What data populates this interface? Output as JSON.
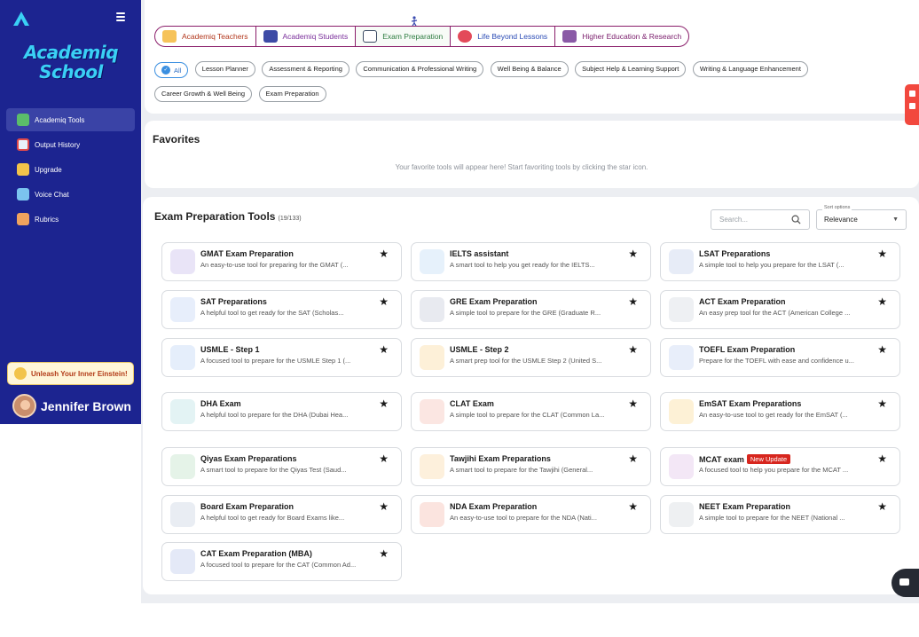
{
  "sidebar": {
    "logo_line1": "Academiq",
    "logo_line2": "School",
    "nav": [
      {
        "label": "Academiq Tools",
        "icon": "tools-icon",
        "active": true
      },
      {
        "label": "Output History",
        "icon": "history-icon",
        "active": false
      },
      {
        "label": "Upgrade",
        "icon": "upgrade-icon",
        "active": false
      },
      {
        "label": "Voice Chat",
        "icon": "voice-chat-icon",
        "active": false
      },
      {
        "label": "Rubrics",
        "icon": "rubrics-icon",
        "active": false
      }
    ],
    "promo": "Unleash Your Inner Einstein!",
    "user_name": "Jennifer Brown"
  },
  "categories": [
    {
      "label": "Academiq Teachers",
      "icon": "teacher-icon"
    },
    {
      "label": "Academiq Students",
      "icon": "students-icon"
    },
    {
      "label": "Exam Preparation",
      "icon": "book-icon"
    },
    {
      "label": "Life Beyond Lessons",
      "icon": "person-icon"
    },
    {
      "label": "Higher Education & Research",
      "icon": "university-icon"
    }
  ],
  "filters": [
    "All",
    "Lesson Planner",
    "Assessment & Reporting",
    "Communication & Professional Writing",
    "Well Being & Balance",
    "Subject Help & Learning Support",
    "Writing & Language Enhancement",
    "Career Growth & Well Being",
    "Exam Preparation"
  ],
  "favorites": {
    "title": "Favorites",
    "empty": "Your favorite tools will appear here! Start favoriting tools by clicking the star icon."
  },
  "tools": {
    "title": "Exam Preparation Tools",
    "count": "(19/133)",
    "search_placeholder": "Search...",
    "sort_label": "Sort options",
    "sort_value": "Relevance",
    "star": "★",
    "badge": "New Update",
    "items": [
      {
        "title": "GMAT Exam Preparation",
        "desc": "An easy-to-use tool for preparing for the GMAT (...",
        "icon": "gmat-icon",
        "color": "#e9e4f7"
      },
      {
        "title": "IELTS assistant",
        "desc": "A smart tool to help you get ready for the IELTS...",
        "icon": "ielts-icon",
        "color": "#e6f1fb"
      },
      {
        "title": "LSAT Preparations",
        "desc": "A simple tool to help you prepare for the LSAT (...",
        "icon": "lsat-icon",
        "color": "#e7ecf7"
      },
      {
        "title": "SAT Preparations",
        "desc": "A helpful tool to get ready for the SAT (Scholas...",
        "icon": "sat-icon",
        "color": "#e7eefb"
      },
      {
        "title": "GRE Exam Preparation",
        "desc": "A simple tool to prepare for the GRE (Graduate R...",
        "icon": "gre-icon",
        "color": "#e8eaf0"
      },
      {
        "title": "ACT Exam Preparation",
        "desc": "An easy prep tool for the ACT (American College ...",
        "icon": "act-icon",
        "color": "#eef0f3"
      },
      {
        "title": "USMLE - Step 1",
        "desc": "A focused tool to prepare for the USMLE Step 1 (...",
        "icon": "usmle1-icon",
        "color": "#e5eefb"
      },
      {
        "title": "USMLE - Step 2",
        "desc": "A smart prep tool for the USMLE Step 2 (United S...",
        "icon": "usmle2-icon",
        "color": "#fdf0d8"
      },
      {
        "title": "TOEFL Exam Preparation",
        "desc": "Prepare for the TOEFL with ease and confidence u...",
        "icon": "toefl-icon",
        "color": "#e8eefa"
      },
      {
        "title": "DHA Exam",
        "desc": "A helpful tool to prepare for the DHA (Dubai Hea...",
        "icon": "dha-icon",
        "color": "#e3f3f4"
      },
      {
        "title": "CLAT Exam",
        "desc": "A simple tool to prepare for the CLAT (Common La...",
        "icon": "clat-icon",
        "color": "#fbe6e2"
      },
      {
        "title": "EmSAT Exam Preparations",
        "desc": "An easy-to-use tool to get ready for the EmSAT (...",
        "icon": "emsat-icon",
        "color": "#fdf1d6"
      },
      {
        "title": "Qiyas Exam Preparations",
        "desc": "A smart tool to prepare for the Qiyas Test (Saud...",
        "icon": "qiyas-icon",
        "color": "#e5f3e8"
      },
      {
        "title": "Tawjihi Exam Preparations",
        "desc": "A smart tool to prepare for the Tawjihi (General...",
        "icon": "tawjihi-icon",
        "color": "#fdf0dc"
      },
      {
        "title": "MCAT exam",
        "desc": "A focused tool to help you prepare for the MCAT ...",
        "icon": "mcat-icon",
        "color": "#f3e7f6",
        "badge": true
      },
      {
        "title": "Board Exam Preparation",
        "desc": "A helpful tool to get ready for Board Exams like...",
        "icon": "board-icon",
        "color": "#e9edf3"
      },
      {
        "title": "NDA Exam Preparation",
        "desc": "An easy-to-use tool to prepare for the NDA (Nati...",
        "icon": "nda-icon",
        "color": "#fbe4df"
      },
      {
        "title": "NEET Exam Preparation",
        "desc": "A simple tool to prepare for the NEET (National ...",
        "icon": "neet-icon",
        "color": "#eef0f2"
      },
      {
        "title": "CAT Exam Preparation (MBA)",
        "desc": "A focused tool to prepare for the CAT (Common Ad...",
        "icon": "cat-icon",
        "color": "#e4e9f7"
      }
    ]
  },
  "colors": {
    "sidebar": "#1c2490",
    "logo": "#3ad0f5",
    "accent": "#8a1d6a",
    "badge": "#d7261e"
  }
}
